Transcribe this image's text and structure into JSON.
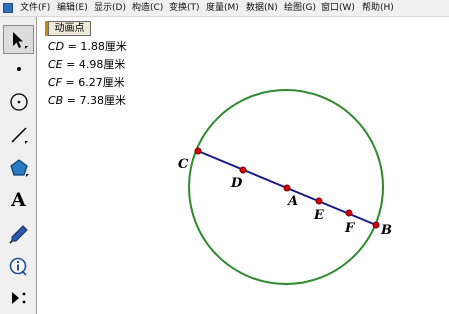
{
  "menu": {
    "items": [
      {
        "id": "file",
        "label": "文件(F)"
      },
      {
        "id": "edit",
        "label": "编辑(E)"
      },
      {
        "id": "display",
        "label": "显示(D)"
      },
      {
        "id": "construct",
        "label": "构造(C)"
      },
      {
        "id": "transform",
        "label": "变换(T)"
      },
      {
        "id": "measure",
        "label": "度量(M)"
      },
      {
        "id": "data",
        "label": "数据(N)"
      },
      {
        "id": "graph",
        "label": "绘图(G)"
      },
      {
        "id": "window",
        "label": "窗口(W)"
      },
      {
        "id": "help",
        "label": "帮助(H)"
      }
    ]
  },
  "toolbar": {
    "tools": [
      {
        "id": "select",
        "icon": "arrow-select-icon",
        "selected": true
      },
      {
        "id": "point",
        "icon": "point-icon"
      },
      {
        "id": "compass",
        "icon": "compass-circle-icon"
      },
      {
        "id": "straightedge",
        "icon": "straightedge-icon"
      },
      {
        "id": "polygon",
        "icon": "polygon-icon"
      },
      {
        "id": "text",
        "icon": "text-icon",
        "glyph": "A"
      },
      {
        "id": "marker",
        "icon": "marker-pen-icon"
      },
      {
        "id": "info",
        "icon": "information-icon"
      },
      {
        "id": "custom",
        "icon": "custom-tools-icon"
      }
    ]
  },
  "canvas": {
    "animation_button": {
      "label": "动画点"
    },
    "measurements": [
      {
        "segment": "CD",
        "equals": " = ",
        "value": "1.88",
        "unit": "厘米"
      },
      {
        "segment": "CE",
        "equals": " = ",
        "value": "4.98",
        "unit": "厘米"
      },
      {
        "segment": "CF",
        "equals": " = ",
        "value": "6.27",
        "unit": "厘米"
      },
      {
        "segment": "CB",
        "equals": " = ",
        "value": "7.38",
        "unit": "厘米"
      }
    ],
    "points": [
      {
        "label": "C"
      },
      {
        "label": "D"
      },
      {
        "label": "A"
      },
      {
        "label": "E"
      },
      {
        "label": "F"
      },
      {
        "label": "B"
      }
    ],
    "colors": {
      "circle": "#2e8b2e",
      "segment": "#1a1a8c",
      "point_fill": "#d8000c",
      "point_stroke": "#7a0000"
    }
  }
}
